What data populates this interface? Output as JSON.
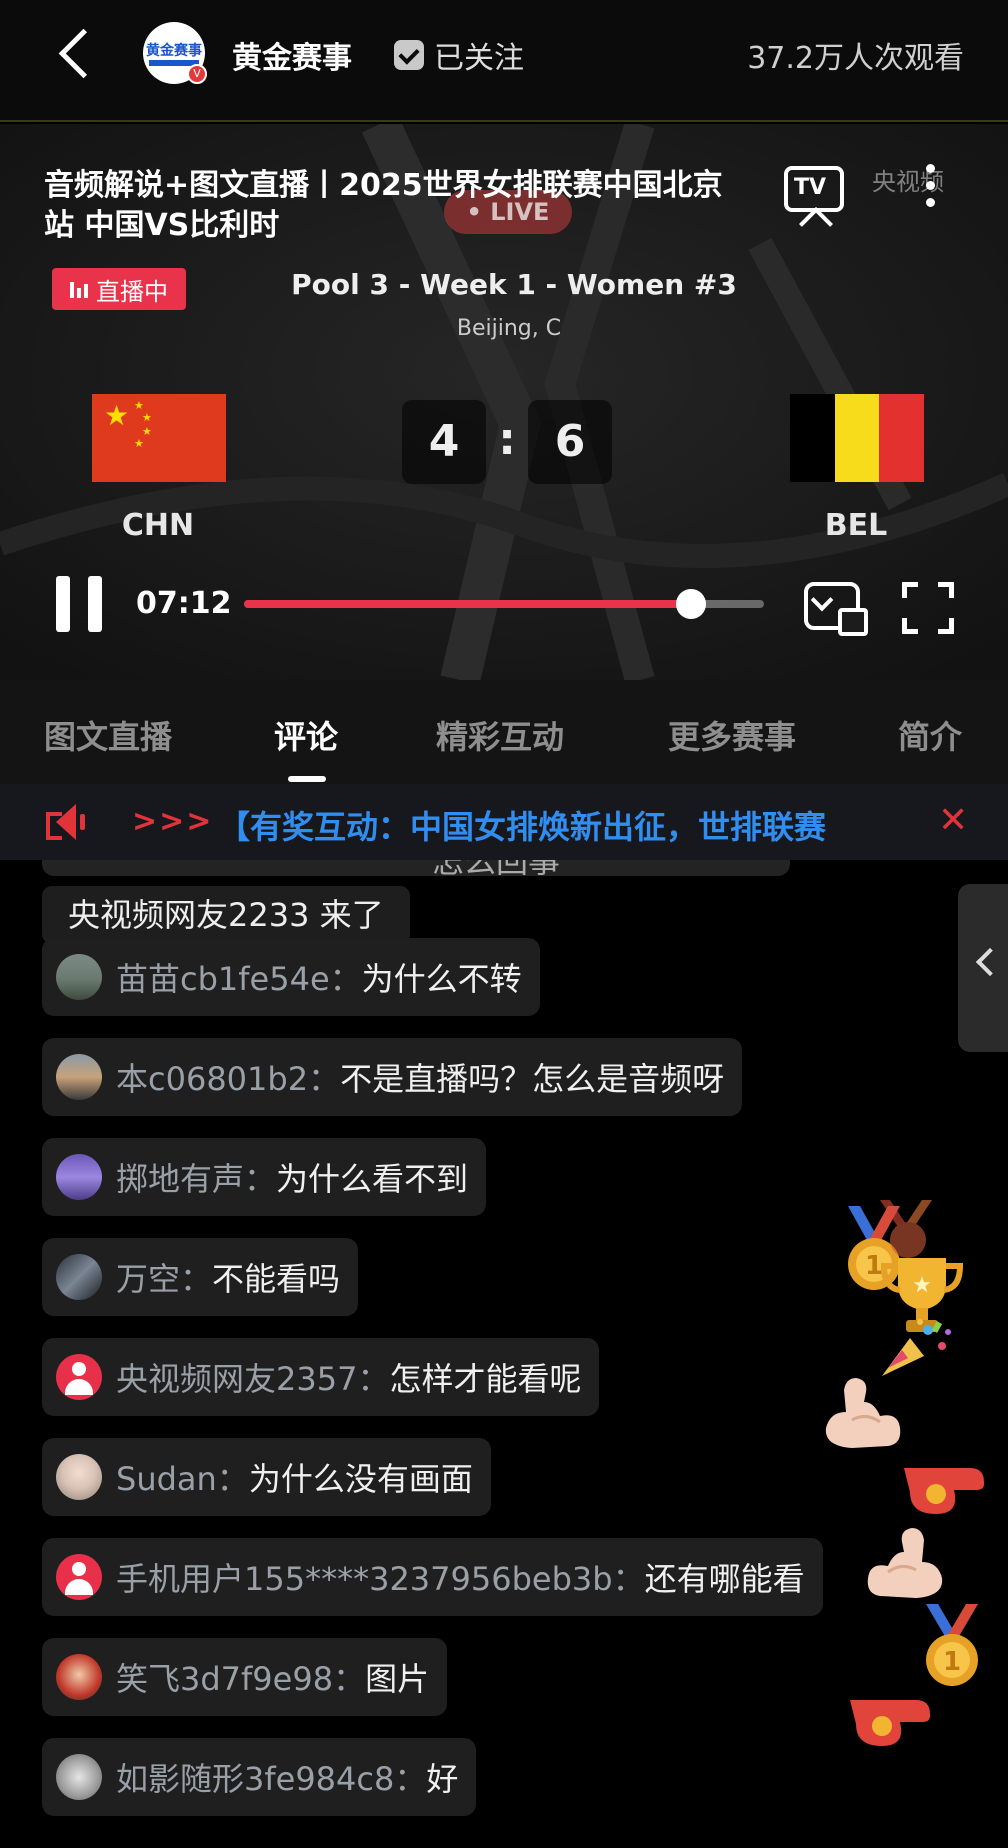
{
  "header": {
    "channel_name": "黄金赛事",
    "channel_logo_text": "黄金赛事",
    "follow_label": "已关注",
    "view_count": "37.2万人次观看"
  },
  "player": {
    "title": "音频解说+图文直播丨2025世界女排联赛中国北京站 中国VS比利时",
    "live_watermark": "• LIVE",
    "cctv_watermark": "央视频",
    "tv_label": "TV",
    "live_badge": "直播中",
    "pool_title": "Pool 3 - Week 1 - Women #3",
    "venue": "Beijing, C",
    "home_team": "CHN",
    "away_team": "BEL",
    "home_score": "4",
    "away_score": "6",
    "score_separator": ":",
    "elapsed_time": "07:12",
    "progress": 0.86,
    "colors": {
      "accent": "#e8334a",
      "chn_red": "#e03a1e",
      "chn_star": "#ffde00",
      "bel_black": "#000000",
      "bel_yellow": "#f6dc1a",
      "bel_red": "#e2312f"
    }
  },
  "tabs": [
    {
      "label": "图文直播",
      "active": false
    },
    {
      "label": "评论",
      "active": true
    },
    {
      "label": "精彩互动",
      "active": false
    },
    {
      "label": "更多赛事",
      "active": false
    },
    {
      "label": "简介",
      "active": false
    }
  ],
  "notice": {
    "chevrons": ">>>",
    "text": "【有奖互动：中国女排焕新出征，世排联赛",
    "close": "✕",
    "text_color": "#2f8ef0"
  },
  "comments": {
    "partial_text": "怎么回事",
    "join_notice": "央视频网友2233 来了",
    "items": [
      {
        "user": "苗苗cb1fe54e：",
        "text": "为什么不转",
        "avatar": "landscape"
      },
      {
        "user": "本c06801b2：",
        "text": "不是直播吗？怎么是音频呀",
        "avatar": "sunset"
      },
      {
        "user": "掷地有声：",
        "text": "为什么看不到",
        "avatar": "tower"
      },
      {
        "user": "万空：",
        "text": "不能看吗",
        "avatar": "dark-portrait"
      },
      {
        "user": "央视频网友2357：",
        "text": "怎样才能看呢",
        "avatar": "default-user"
      },
      {
        "user": "Sudan：",
        "text": "为什么没有画面",
        "avatar": "girl-portrait"
      },
      {
        "user": "手机用户155****3237956beb3b：",
        "text": "还有哪能看",
        "avatar": "default-user"
      },
      {
        "user": "笑飞3d7f9e98：",
        "text": "图片",
        "avatar": "cartoon-boy"
      },
      {
        "user": "如影随形3fe984c8：",
        "text": "好",
        "avatar": "grey-orb"
      }
    ]
  },
  "reactions": [
    "medal-icon",
    "medal-icon",
    "trophy-icon",
    "party-popper-icon",
    "flexed-bicep-icon",
    "whistle-icon",
    "flexed-bicep-icon",
    "medal-icon",
    "whistle-icon"
  ]
}
